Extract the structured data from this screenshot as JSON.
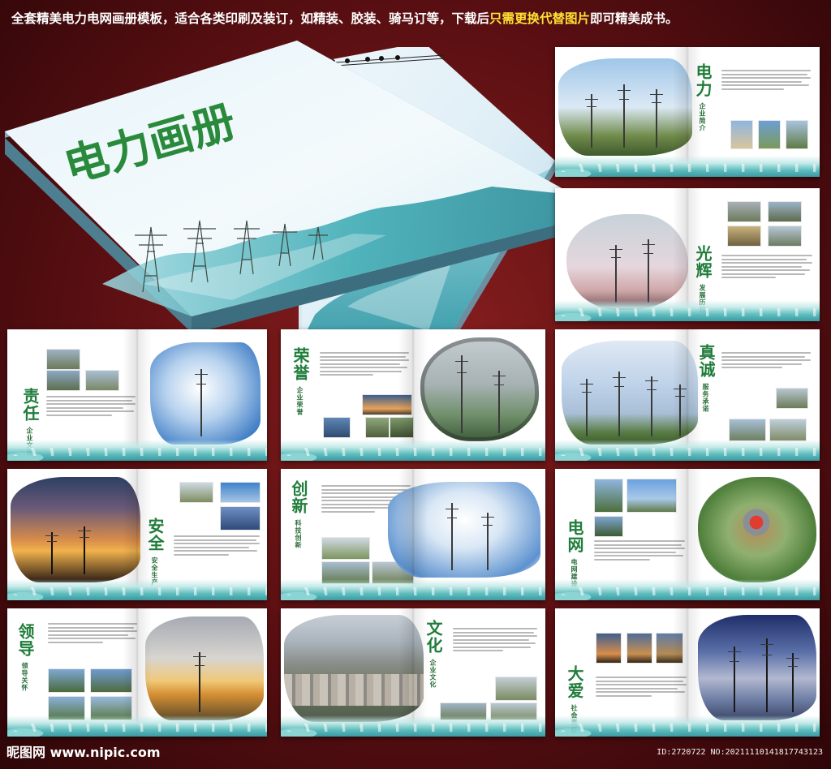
{
  "headline": {
    "part1": "全套精美电力电网画册模板，适合各类印刷及装订，如精装、胶装、骑马订等，下载后",
    "highlight": "只需更换代替图片",
    "part2": "即可精美成书。"
  },
  "cover": {
    "title": "电力画册"
  },
  "spreads": [
    {
      "key": "s1",
      "title": "电力",
      "subtitle": "企业简介"
    },
    {
      "key": "s2",
      "title": "光辉",
      "subtitle": "发展历程"
    },
    {
      "key": "s3",
      "title": "责任",
      "subtitle": "企业文化"
    },
    {
      "key": "s4",
      "title": "荣誉",
      "subtitle": "企业荣誉"
    },
    {
      "key": "s5",
      "title": "真诚",
      "subtitle": "服务承诺"
    },
    {
      "key": "s6",
      "title": "安全",
      "subtitle": "安全生产"
    },
    {
      "key": "s7",
      "title": "创新",
      "subtitle": "科技创新"
    },
    {
      "key": "s8",
      "title": "电网",
      "subtitle": "电网建设"
    },
    {
      "key": "s9",
      "title": "领导",
      "subtitle": "领导关怀"
    },
    {
      "key": "s10",
      "title": "文化",
      "subtitle": "企业文化"
    },
    {
      "key": "s11",
      "title": "大爱",
      "subtitle": "社会责任"
    }
  ],
  "footer": {
    "logo_text": "昵图网 www.nipic.com",
    "id_text": "ID:2720722 NO:20211110141817743123"
  },
  "colors": {
    "background": "#5a0f12",
    "headline_text": "#ffffff",
    "highlight_text": "#ffe233",
    "title_green": "#1f7d3a",
    "teal": "#2a8f99"
  }
}
